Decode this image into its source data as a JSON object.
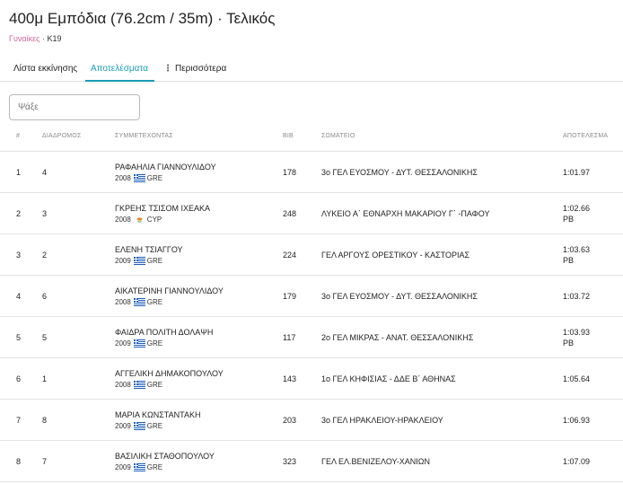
{
  "header": {
    "title": "400μ Εμπόδια (76.2cm / 35m) · Τελικός",
    "category": "Γυναίκες",
    "separator": " · ",
    "age_group": "K19"
  },
  "tabs": [
    {
      "label": "Λίστα εκκίνησης"
    },
    {
      "label": "Αποτελέσματα"
    },
    {
      "label": "Περισσότερα"
    }
  ],
  "search": {
    "placeholder": "Ψάξε"
  },
  "table": {
    "headers": {
      "rank": "#",
      "lane": "ΔΙΑΔΡΟΜΟΣ",
      "athlete": "ΣΥΜΜΕΤΕΧΟΝΤΑΣ",
      "bib": "BIB",
      "club": "ΣΩΜΑΤΕΙΟ",
      "result": "ΑΠΟΤΕΛΕΣΜΑ"
    },
    "rows": [
      {
        "rank": "1",
        "lane": "4",
        "name": "ΡΑΦΑΗΛΙΑ ΓΙΑΝΝΟΥΛΙΔΟΥ",
        "year": "2008",
        "flag": "greece-flag-icon",
        "country": "GRE",
        "bib": "178",
        "club": "3ο ΓΕΛ ΕΥΟΣΜΟΥ - ΔΥΤ. ΘΕΣΣΑΛΟΝΙΚΗΣ",
        "result": "1:01.97",
        "note": ""
      },
      {
        "rank": "2",
        "lane": "3",
        "name": "ΓΚΡΕΗΣ ΤΣΙΣΟΜ ΙΧΕΑΚΑ",
        "year": "2008",
        "flag": "cyprus-flag-icon",
        "country": "CYP",
        "bib": "248",
        "club": "ΛΥΚΕΙΟ Α΄ ΕΘΝΑΡΧΗ ΜΑΚΑΡΙΟΥ Γ΄ -ΠΑΦΟΥ",
        "result": "1:02.66",
        "note": "PB"
      },
      {
        "rank": "3",
        "lane": "2",
        "name": "ΕΛΕΝΗ ΤΣΙΑΓΓΟΥ",
        "year": "2009",
        "flag": "greece-flag-icon",
        "country": "GRE",
        "bib": "224",
        "club": "ΓΕΛ ΑΡΓΟΥΣ ΟΡΕΣΤΙΚΟΥ - ΚΑΣΤΟΡΙΑΣ",
        "result": "1:03.63",
        "note": "PB"
      },
      {
        "rank": "4",
        "lane": "6",
        "name": "ΑΙΚΑΤΕΡΙΝΗ ΓΙΑΝΝΟΥΛΙΔΟΥ",
        "year": "2008",
        "flag": "greece-flag-icon",
        "country": "GRE",
        "bib": "179",
        "club": "3ο ΓΕΛ ΕΥΟΣΜΟΥ - ΔΥΤ. ΘΕΣΣΑΛΟΝΙΚΗΣ",
        "result": "1:03.72",
        "note": ""
      },
      {
        "rank": "5",
        "lane": "5",
        "name": "ΦΑΙΔΡΑ ΠΟΛΙΤΗ ΔΟΛΑΨΗ",
        "year": "2009",
        "flag": "greece-flag-icon",
        "country": "GRE",
        "bib": "117",
        "club": "2ο ΓΕΛ ΜΙΚΡΑΣ - ΑΝΑΤ. ΘΕΣΣΑΛΟΝΙΚΗΣ",
        "result": "1:03.93",
        "note": "PB"
      },
      {
        "rank": "6",
        "lane": "1",
        "name": "ΑΓΓΕΛΙΚΗ ΔΗΜΑΚΟΠΟΥΛΟΥ",
        "year": "2008",
        "flag": "greece-flag-icon",
        "country": "GRE",
        "bib": "143",
        "club": "1ο ΓΕΛ ΚΗΦΙΣΙΑΣ - ΔΔΕ Β΄ ΑΘΗΝΑΣ",
        "result": "1:05.64",
        "note": ""
      },
      {
        "rank": "7",
        "lane": "8",
        "name": "ΜΑΡΙΑ ΚΩΝΣΤΑΝΤΑΚΗ",
        "year": "2009",
        "flag": "greece-flag-icon",
        "country": "GRE",
        "bib": "203",
        "club": "3ο ΓΕΛ ΗΡΑΚΛΕΙΟΥ-ΗΡΑΚΛΕΙΟΥ",
        "result": "1:06.93",
        "note": ""
      },
      {
        "rank": "8",
        "lane": "7",
        "name": "ΒΑΣΙΛΙΚΗ ΣΤΑΘΟΠΟΥΛΟΥ",
        "year": "2009",
        "flag": "greece-flag-icon",
        "country": "GRE",
        "bib": "323",
        "club": "ΓΕΛ ΕΛ.ΒΕΝΙΖΕΛΟΥ-ΧΑΝΙΩΝ",
        "result": "1:07.09",
        "note": ""
      }
    ]
  },
  "colors": {
    "accent": "#1b9ab3",
    "category": "#d0679a",
    "border": "#e2e2e2",
    "header_text": "#8a8a8a"
  }
}
